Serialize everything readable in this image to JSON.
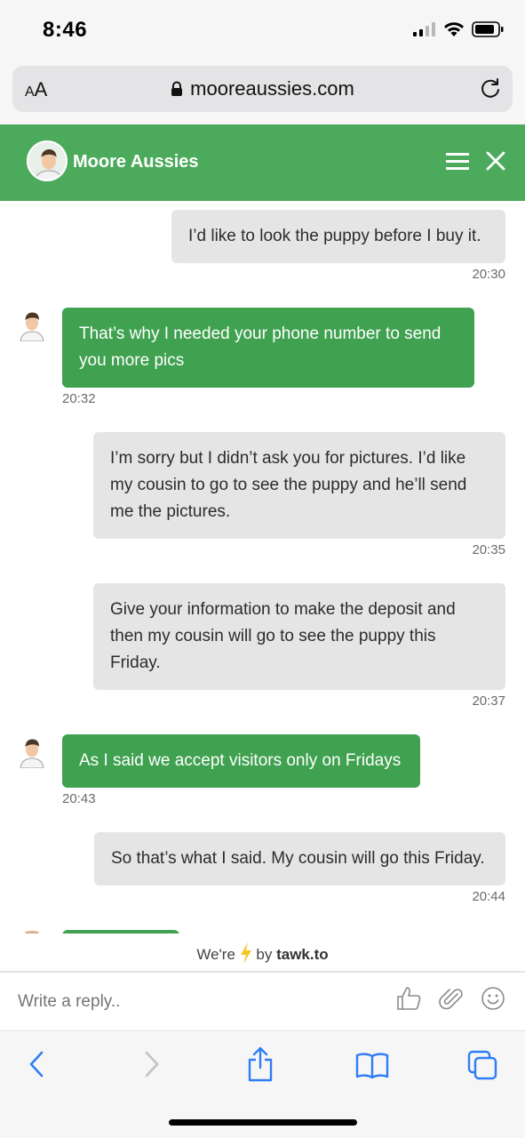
{
  "status_bar": {
    "time": "8:46"
  },
  "browser": {
    "text_size_label": "AA",
    "url": "mooreaussies.com"
  },
  "chat": {
    "title": "Moore Aussies",
    "messages": [
      {
        "sender": "visitor",
        "text": "I’d like to look the puppy before I buy it.",
        "time": "20:30"
      },
      {
        "sender": "agent",
        "text": "That’s why I needed your phone number to send you more pics",
        "time": "20:32"
      },
      {
        "sender": "visitor",
        "text": "I’m sorry but I didn’t ask you for pictures. I’d like my cousin to go to see the puppy and he’ll send me the pictures.",
        "time": "20:35"
      },
      {
        "sender": "visitor",
        "text": "Give your information to make the deposit and then my cousin will go to see the puppy this Friday.",
        "time": "20:37"
      },
      {
        "sender": "agent",
        "text": "As I said we accept visitors only on Fridays",
        "time": "20:43"
      },
      {
        "sender": "visitor",
        "text": "So that’s what I said. My cousin will go this Friday.",
        "time": "20:44"
      }
    ],
    "powered_prefix": "We're",
    "powered_suffix": "by",
    "powered_brand": "tawk.to",
    "reply_placeholder": "Write a reply..",
    "accent_color": "#4caa5c"
  },
  "toolbar": {
    "icons": [
      "back-icon",
      "forward-icon",
      "share-icon",
      "bookmarks-icon",
      "tabs-icon"
    ]
  }
}
